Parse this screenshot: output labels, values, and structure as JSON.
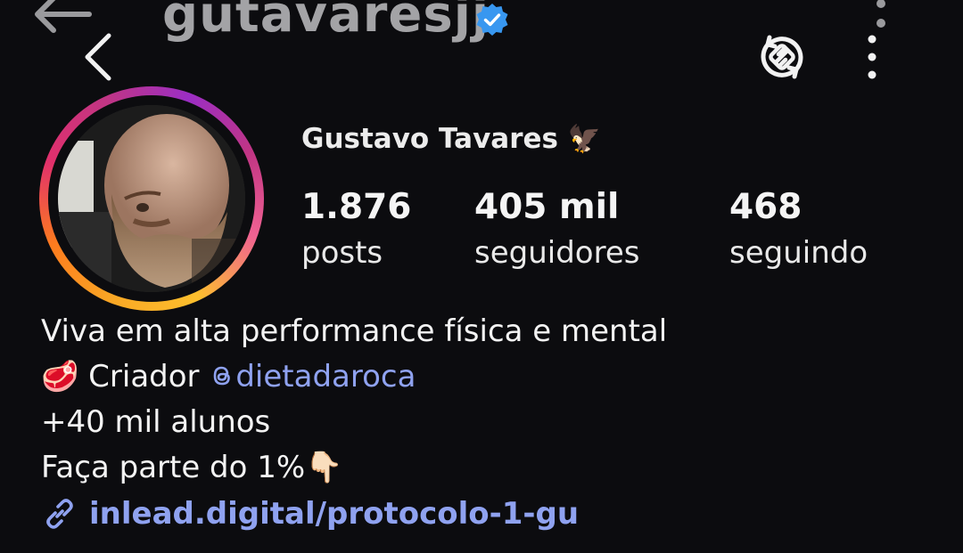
{
  "header": {
    "username": "gutavaresjj",
    "verified": true,
    "back_icon": "chevron-left-icon",
    "sync_icon": "sync-icon",
    "more_icon": "more-vertical-icon"
  },
  "profile": {
    "display_name": "Gustavo Tavares",
    "name_emoji": "🦅",
    "stats": [
      {
        "value": "1.876",
        "label": "posts"
      },
      {
        "value": "405 mil",
        "label": "seguidores"
      },
      {
        "value": "468",
        "label": "seguindo"
      }
    ]
  },
  "bio": {
    "line1": "Viva em alta performance física e mental",
    "line2_emoji": "🥩",
    "line2_text": "Criador",
    "line2_mention": "dietadaroca",
    "line3": "+40 mil alunos",
    "line4_text": "Faça parte do 1%",
    "line4_emoji": "👇🏻",
    "link": "inlead.digital/protocolo-1-gu"
  },
  "colors": {
    "background": "#0c0c0f",
    "link": "#8fa2f0",
    "verified": "#3897f0"
  }
}
